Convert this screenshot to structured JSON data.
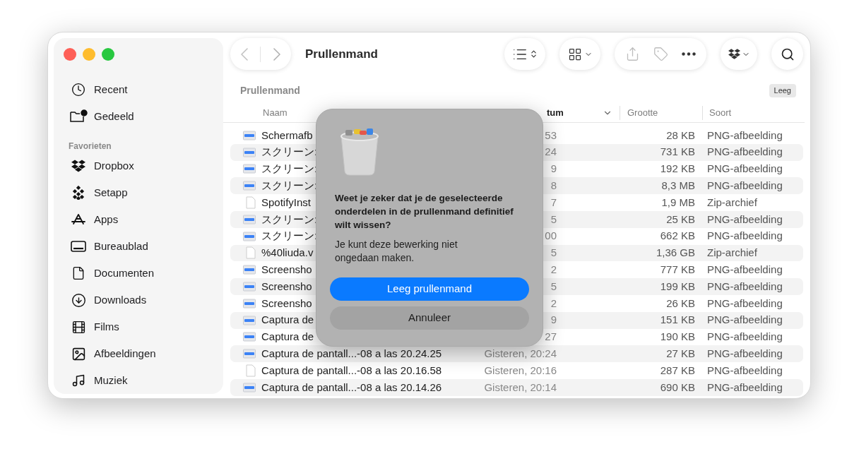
{
  "sidebar": {
    "items": [
      {
        "label": "Recent"
      },
      {
        "label": "Gedeeld"
      }
    ],
    "sections": [
      {
        "title": "Favorieten",
        "items": [
          {
            "label": "Dropbox"
          },
          {
            "label": "Setapp"
          },
          {
            "label": "Apps"
          },
          {
            "label": "Bureaublad"
          },
          {
            "label": "Documenten"
          },
          {
            "label": "Downloads"
          },
          {
            "label": "Films"
          },
          {
            "label": "Afbeeldingen"
          },
          {
            "label": "Muziek"
          }
        ]
      }
    ]
  },
  "toolbar": {
    "back": {
      "disabled": true
    },
    "forward": {
      "disabled": true
    },
    "title": "Prullenmand",
    "share": {
      "disabled": true
    },
    "tag": {
      "disabled": true
    }
  },
  "location": {
    "title": "Prullenmand",
    "empty_button": "Leeg"
  },
  "table": {
    "columns": [
      {
        "label": "Naam",
        "sorted": false
      },
      {
        "label": "tum",
        "sorted": true
      },
      {
        "label": "Grootte",
        "sorted": false
      },
      {
        "label": "Soort",
        "sorted": false
      }
    ],
    "rows": [
      {
        "kind": "image",
        "name": "Schermafb",
        "date": "53",
        "size": "28 KB",
        "type": "PNG-afbeelding"
      },
      {
        "kind": "image",
        "name": "スクリーン:",
        "date": "24",
        "size": "731 KB",
        "type": "PNG-afbeelding"
      },
      {
        "kind": "image",
        "name": "スクリーン:",
        "date": "9",
        "size": "192 KB",
        "type": "PNG-afbeelding"
      },
      {
        "kind": "image",
        "name": "スクリーン:",
        "date": "8",
        "size": "8,3 MB",
        "type": "PNG-afbeelding"
      },
      {
        "kind": "document",
        "name": "SpotifyInst",
        "date": "7",
        "size": "1,9 MB",
        "type": "Zip-archief"
      },
      {
        "kind": "image",
        "name": "スクリーン:",
        "date": "5",
        "size": "25 KB",
        "type": "PNG-afbeelding"
      },
      {
        "kind": "image",
        "name": "スクリーン:",
        "date": "00",
        "size": "662 KB",
        "type": "PNG-afbeelding"
      },
      {
        "kind": "document",
        "name": "%40liuda.v",
        "date": "5",
        "size": "1,36 GB",
        "type": "Zip-archief"
      },
      {
        "kind": "image",
        "name": "Screensho",
        "date": "2",
        "size": "777 KB",
        "type": "PNG-afbeelding"
      },
      {
        "kind": "image",
        "name": "Screensho",
        "date": "5",
        "size": "199 KB",
        "type": "PNG-afbeelding"
      },
      {
        "kind": "image",
        "name": "Screensho",
        "date": "2",
        "size": "26 KB",
        "type": "PNG-afbeelding"
      },
      {
        "kind": "image",
        "name": "Captura de",
        "date": "9",
        "size": "151 KB",
        "type": "PNG-afbeelding"
      },
      {
        "kind": "image",
        "name": "Captura de",
        "date": "27",
        "size": "190 KB",
        "type": "PNG-afbeelding"
      },
      {
        "kind": "image",
        "name": "Captura de pantall...-08 a las 20.24.25",
        "date": "Gisteren, 20:24",
        "size": "27 KB",
        "type": "PNG-afbeelding"
      },
      {
        "kind": "document",
        "name": "Captura de pantall...-08 a las 20.16.58",
        "date": "Gisteren, 20:16",
        "size": "287 KB",
        "type": "PNG-afbeelding"
      },
      {
        "kind": "image",
        "name": "Captura de pantall...-08 a las 20.14.26",
        "date": "Gisteren, 20:14",
        "size": "690 KB",
        "type": "PNG-afbeelding"
      }
    ]
  },
  "dialog": {
    "title": "Weet je zeker dat je de geselecteerde onderdelen in de prullenmand definitief wilt wissen?",
    "message": "Je kunt deze bewerking niet ongedaan maken.",
    "buttons": [
      {
        "label": "Leeg prullenmand",
        "kind": "primary"
      },
      {
        "label": "Annuleer",
        "kind": "secondary"
      }
    ]
  }
}
